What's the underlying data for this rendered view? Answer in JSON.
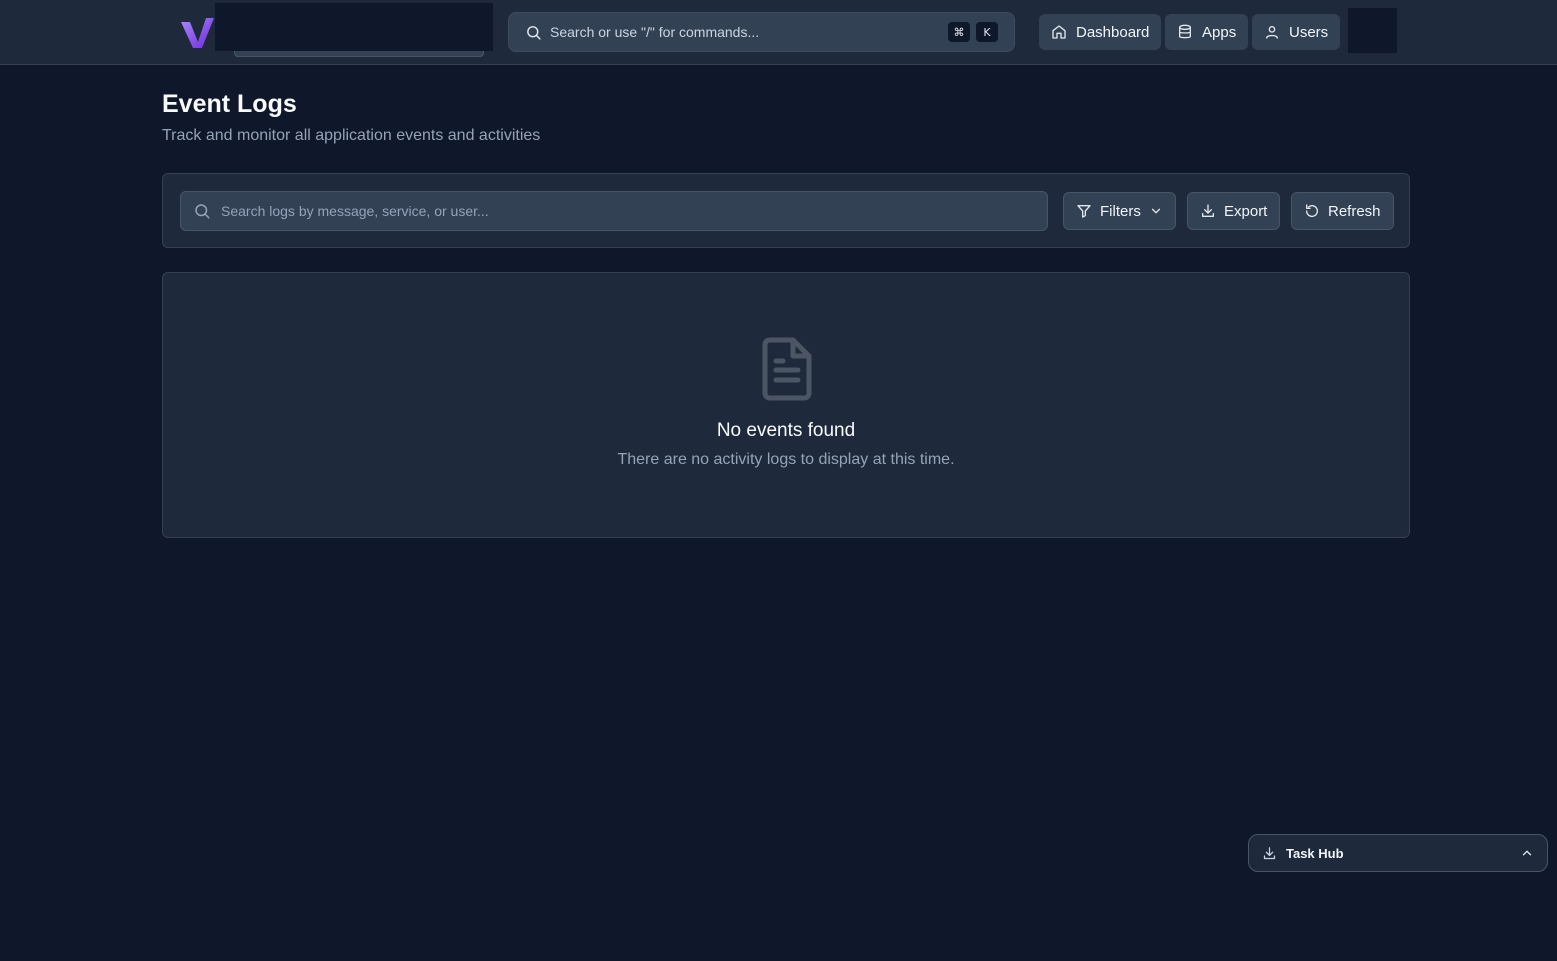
{
  "topbar": {
    "command_search": {
      "placeholder": "Search or use \"/\" for commands...",
      "shortcut_keys": [
        "⌘",
        "K"
      ]
    },
    "nav": [
      {
        "label": "Dashboard",
        "icon": "home-icon"
      },
      {
        "label": "Apps",
        "icon": "database-icon"
      },
      {
        "label": "Users",
        "icon": "user-icon"
      }
    ]
  },
  "header": {
    "title": "Event Logs",
    "subtitle": "Track and monitor all application events and activities"
  },
  "toolbar": {
    "search_placeholder": "Search logs by message, service, or user...",
    "filters_label": "Filters",
    "export_label": "Export",
    "refresh_label": "Refresh"
  },
  "empty_state": {
    "icon": "file-text-icon",
    "title": "No events found",
    "message": "There are no activity logs to display at this time."
  },
  "task_hub": {
    "label": "Task Hub"
  },
  "colors": {
    "background": "#0f172a",
    "surface": "#1e293b",
    "control": "#334155",
    "border": "#475569",
    "muted_text": "#94a3b8",
    "logo_accent": "#8b5cf6"
  }
}
